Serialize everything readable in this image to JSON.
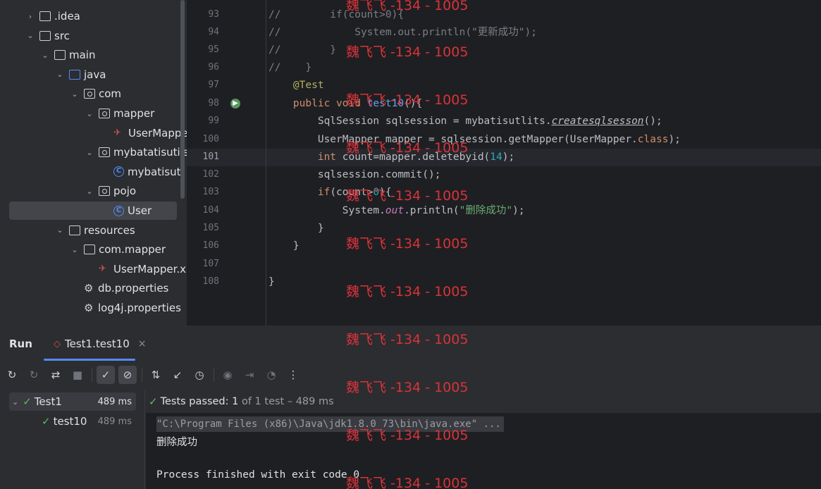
{
  "project_tree": {
    "items": [
      {
        "label": ".idea",
        "kind": "folder",
        "indent": 0,
        "chevron": "›"
      },
      {
        "label": "src",
        "kind": "folder",
        "indent": 0,
        "chevron": "⌄"
      },
      {
        "label": "main",
        "kind": "folder",
        "indent": 1,
        "chevron": "⌄"
      },
      {
        "label": "java",
        "kind": "folder-blue",
        "indent": 2,
        "chevron": "⌄"
      },
      {
        "label": "com",
        "kind": "package",
        "indent": 3,
        "chevron": "⌄"
      },
      {
        "label": "mapper",
        "kind": "package",
        "indent": 4,
        "chevron": "⌄"
      },
      {
        "label": "UserMappe",
        "kind": "mybatis",
        "indent": 5,
        "chevron": ""
      },
      {
        "label": "mybatatisutils",
        "kind": "package",
        "indent": 4,
        "chevron": "⌄"
      },
      {
        "label": "mybatisutl",
        "kind": "class",
        "indent": 5,
        "chevron": ""
      },
      {
        "label": "pojo",
        "kind": "package",
        "indent": 4,
        "chevron": "⌄"
      },
      {
        "label": "User",
        "kind": "class",
        "indent": 5,
        "chevron": "",
        "selected": true
      },
      {
        "label": "resources",
        "kind": "folder-res",
        "indent": 2,
        "chevron": "⌄"
      },
      {
        "label": "com.mapper",
        "kind": "folder",
        "indent": 3,
        "chevron": "⌄"
      },
      {
        "label": "UserMapper.x",
        "kind": "mybatis",
        "indent": 4,
        "chevron": ""
      },
      {
        "label": "db.properties",
        "kind": "gear",
        "indent": 3,
        "chevron": ""
      },
      {
        "label": "log4j.properties",
        "kind": "gear",
        "indent": 3,
        "chevron": ""
      }
    ]
  },
  "editor": {
    "line_numbers": [
      "93",
      "94",
      "95",
      "96",
      "97",
      "98",
      "99",
      "100",
      "101",
      "102",
      "103",
      "104",
      "105",
      "106",
      "107",
      "108"
    ],
    "current_line": "101"
  },
  "run_panel": {
    "title": "Run",
    "tab_label": "Test1.test10",
    "tab_close": "×",
    "tests": [
      {
        "name": "Test1",
        "time": "489 ms",
        "selected": true
      },
      {
        "name": "test10",
        "time": "489 ms",
        "selected": false
      }
    ],
    "status_prefix": "Tests passed:",
    "status_count": "1",
    "status_suffix": "of 1 test – 489 ms",
    "command": "\"C:\\Program Files (x86)\\Java\\jdk1.8.0_73\\bin\\java.exe\" ...",
    "output_line": "删除成功",
    "exit_line": "Process finished with exit code 0"
  },
  "watermark": {
    "text": "魏飞飞 -134 - 1005"
  },
  "colors": {
    "accent": "#548af7",
    "pass": "#5fb865",
    "watermark": "#d9333a"
  }
}
